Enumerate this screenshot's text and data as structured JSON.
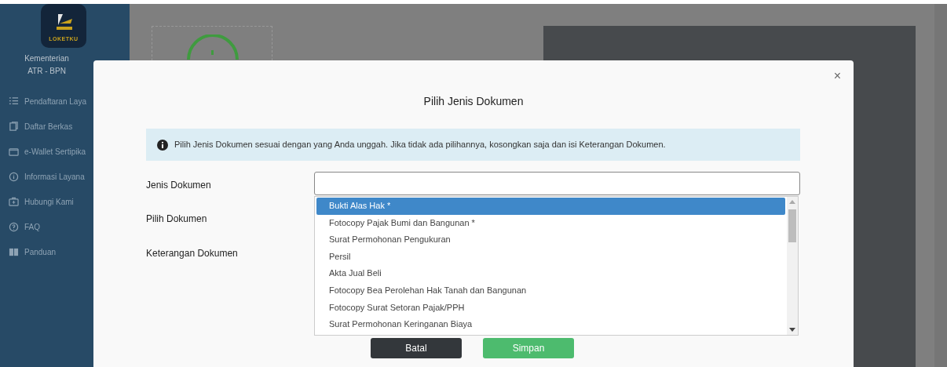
{
  "sidebar": {
    "logo_text": "LOKETKU",
    "org": [
      "Kementerian",
      "ATR - BPN"
    ],
    "items": [
      {
        "label": "Pendaftaran Laya"
      },
      {
        "label": "Daftar Berkas"
      },
      {
        "label": "e-Wallet Sertipika"
      },
      {
        "label": "Informasi Layana"
      },
      {
        "label": "Hubungi Kami"
      },
      {
        "label": "FAQ"
      },
      {
        "label": "Panduan"
      }
    ]
  },
  "modal": {
    "title": "Pilih Jenis Dokumen",
    "close": "×",
    "alert": "Pilih Jenis Dokumen sesuai dengan yang Anda unggah. Jika tidak ada pilihannya, kosongkan saja dan isi Keterangan Dokumen.",
    "fields": [
      "Jenis Dokumen",
      "Pilih Dokumen",
      "Keterangan Dokumen"
    ],
    "options": [
      {
        "label": "Bukti Alas Hak *",
        "selected": true
      },
      {
        "label": "Fotocopy Pajak Bumi dan Bangunan *",
        "selected": false
      },
      {
        "label": "Surat Permohonan Pengukuran",
        "selected": false
      },
      {
        "label": "Persil",
        "selected": false
      },
      {
        "label": "Akta Jual Beli",
        "selected": false
      },
      {
        "label": "Fotocopy Bea Perolehan Hak Tanah dan Bangunan",
        "selected": false
      },
      {
        "label": "Fotocopy Surat Setoran Pajak/PPH",
        "selected": false
      },
      {
        "label": "Surat Permohonan Keringanan Biaya",
        "selected": false
      }
    ],
    "buttons": [
      {
        "label": "Batal",
        "kind": "cancel"
      },
      {
        "label": "Simpan",
        "kind": "save"
      }
    ]
  }
}
